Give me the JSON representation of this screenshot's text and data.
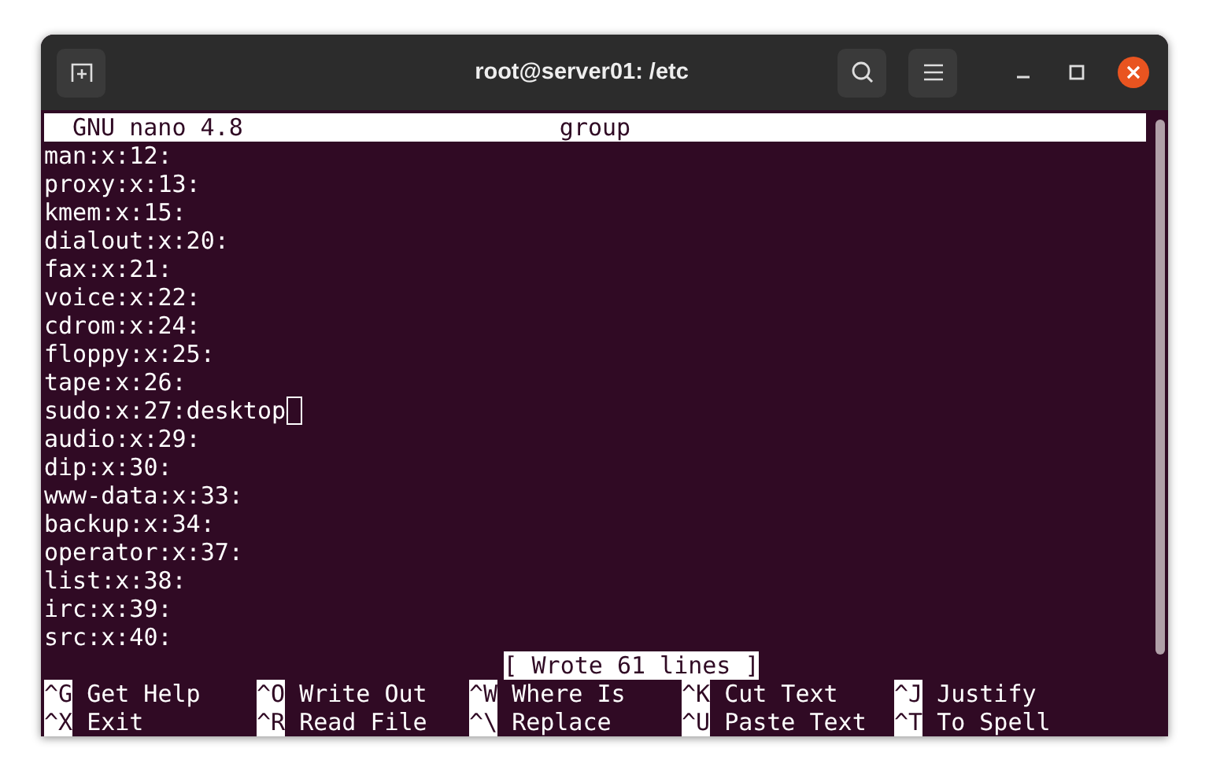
{
  "window": {
    "title": "root@server01: /etc"
  },
  "header": {
    "app": "GNU nano 4.8",
    "filename": "group"
  },
  "lines": [
    {
      "text": "man:x:12:",
      "cursor": false
    },
    {
      "text": "proxy:x:13:",
      "cursor": false
    },
    {
      "text": "kmem:x:15:",
      "cursor": false
    },
    {
      "text": "dialout:x:20:",
      "cursor": false
    },
    {
      "text": "fax:x:21:",
      "cursor": false
    },
    {
      "text": "voice:x:22:",
      "cursor": false
    },
    {
      "text": "cdrom:x:24:",
      "cursor": false
    },
    {
      "text": "floppy:x:25:",
      "cursor": false
    },
    {
      "text": "tape:x:26:",
      "cursor": false
    },
    {
      "text": "sudo:x:27:desktop",
      "cursor": true
    },
    {
      "text": "audio:x:29:",
      "cursor": false
    },
    {
      "text": "dip:x:30:",
      "cursor": false
    },
    {
      "text": "www-data:x:33:",
      "cursor": false
    },
    {
      "text": "backup:x:34:",
      "cursor": false
    },
    {
      "text": "operator:x:37:",
      "cursor": false
    },
    {
      "text": "list:x:38:",
      "cursor": false
    },
    {
      "text": "irc:x:39:",
      "cursor": false
    },
    {
      "text": "src:x:40:",
      "cursor": false
    }
  ],
  "status_message": "[ Wrote 61 lines ]",
  "shortcuts": [
    [
      {
        "key": "^G",
        "label": "Get Help"
      },
      {
        "key": "^O",
        "label": "Write Out"
      },
      {
        "key": "^W",
        "label": "Where Is"
      },
      {
        "key": "^K",
        "label": "Cut Text"
      },
      {
        "key": "^J",
        "label": "Justify"
      }
    ],
    [
      {
        "key": "^X",
        "label": "Exit"
      },
      {
        "key": "^R",
        "label": "Read File"
      },
      {
        "key": "^\\",
        "label": "Replace"
      },
      {
        "key": "^U",
        "label": "Paste Text"
      },
      {
        "key": "^T",
        "label": "To Spell"
      }
    ]
  ]
}
